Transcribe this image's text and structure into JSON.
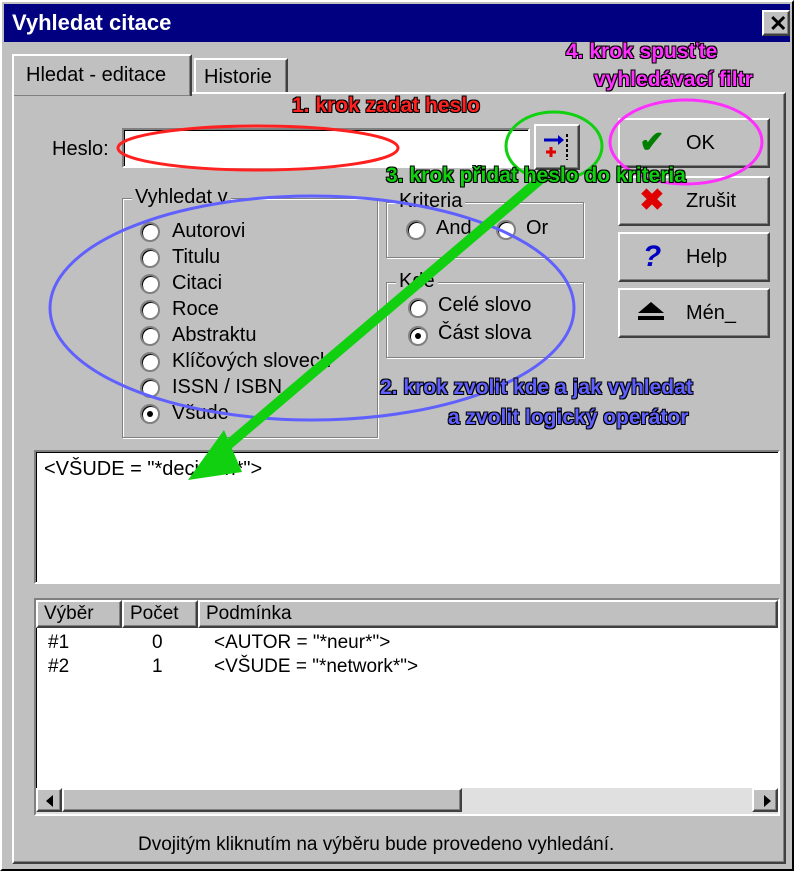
{
  "window": {
    "title": "Vyhledat citace"
  },
  "tabs": [
    {
      "label": "Hledat - editace"
    },
    {
      "label": "Historie"
    }
  ],
  "search": {
    "label": "Heslo:",
    "value": ""
  },
  "search_in": {
    "legend": "Vyhledat v",
    "options": [
      {
        "label": "Autorovi",
        "selected": false
      },
      {
        "label": "Titulu",
        "selected": false
      },
      {
        "label": "Citaci",
        "selected": false
      },
      {
        "label": "Roce",
        "selected": false
      },
      {
        "label": "Abstraktu",
        "selected": false
      },
      {
        "label": "Klíčových slovech",
        "selected": false
      },
      {
        "label": "ISSN / ISBN",
        "selected": false
      },
      {
        "label": "Všude",
        "selected": true
      }
    ]
  },
  "criteria": {
    "legend": "Kriteria",
    "options": [
      {
        "label": "And",
        "selected": false
      },
      {
        "label": "Or",
        "selected": false
      }
    ]
  },
  "where": {
    "legend": "Kde",
    "options": [
      {
        "label": "Celé slovo",
        "selected": false
      },
      {
        "label": "Část slova",
        "selected": true
      }
    ]
  },
  "buttons": {
    "ok": "OK",
    "cancel": "Zrušit",
    "help": "Help",
    "less": "Mén_"
  },
  "query": {
    "text": "<VŠUDE = \"*decision*\">"
  },
  "history": {
    "columns": [
      "Výběr",
      "Počet",
      "Podmínka"
    ],
    "rows": [
      {
        "sel": "#1",
        "count": "0",
        "cond": "<AUTOR = \"*neur*\">"
      },
      {
        "sel": "#2",
        "count": "1",
        "cond": "<VŠUDE = \"*network*\">"
      }
    ]
  },
  "status": {
    "text": "Dvojitým kliknutím na výběru bude provedeno vyhledání."
  },
  "annotations": {
    "step1": "1. krok zadat heslo",
    "step2_line1": "2. krok zvolit kde a jak vyhledat",
    "step2_line2": "a zvolit logický operátor",
    "step3": "3. krok  přidat heslo do kriteria",
    "step4_line1": "4. krok  spusťte",
    "step4_line2": "vyhledávací filtr"
  },
  "colors": {
    "title_bar": "#000080",
    "step1": "#ff2020",
    "step2": "#6060ff",
    "step3": "#10d010",
    "step4": "#ff30ff"
  },
  "icons": {
    "add_criterion": "add-criterion-icon",
    "ok": "checkmark-icon",
    "cancel": "red-x-icon",
    "help": "question-mark-icon",
    "less": "collapse-arrows-icon"
  }
}
